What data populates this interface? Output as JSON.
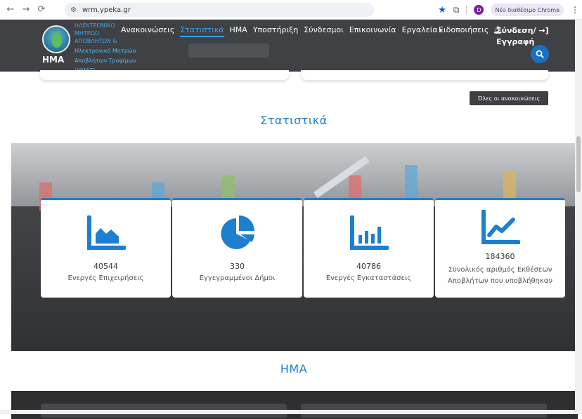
{
  "browser": {
    "url": "wrm.ypeka.gr",
    "new_chrome_label": "Νέο διαθέσιμο Chrome",
    "profile_initial": "D"
  },
  "header": {
    "logo_abbr": "ΗΜΑ",
    "logo_top": "ΗΛΕΚΤΡΟΝΙΚΟ ΜΗΤΡΩΟ ΑΠΟΒΛΗΤΩΝ &",
    "logo_sub": [
      "Ηλεκτρονικό Μητρώο",
      "Αποβλήτων Τροφίμων",
      "(ΗΜΑΤ)"
    ],
    "nav": [
      {
        "label": "Ανακοινώσεις"
      },
      {
        "label": "Στατιστικά"
      },
      {
        "label": "ΗΜΑ"
      },
      {
        "label": "Υποστήριξη"
      },
      {
        "label": "Σύνδεσμοι"
      },
      {
        "label": "Επικοινωνία"
      },
      {
        "label": "Εργαλεία"
      }
    ],
    "notifications_label": "Ειδοποιήσεις",
    "login_line1": "Σύνδεση/",
    "login_line2": "Εγγραφή"
  },
  "announcements": {
    "all_button": "Όλες οι ανακοινώσεις"
  },
  "stats": {
    "title": "Στατιστικά",
    "cards": [
      {
        "value": "40544",
        "label": "Ενεργές Επιχειρήσεις",
        "icon": "area-chart-icon"
      },
      {
        "value": "330",
        "label": "Εγγεγραμμένοι Δήμοι",
        "icon": "pie-chart-icon"
      },
      {
        "value": "40786",
        "label": "Ενεργές Εγκαταστάσεις",
        "icon": "bar-chart-icon"
      },
      {
        "value": "184360",
        "label": "Συνολικός αριθμός Εκθέσεων Αποβλήτων που υποβλήθηκαν",
        "icon": "line-chart-icon"
      }
    ]
  },
  "hma": {
    "title": "ΗΜΑ"
  },
  "colors": {
    "accent": "#1c7fd0",
    "header_bg": "#3f4145"
  }
}
